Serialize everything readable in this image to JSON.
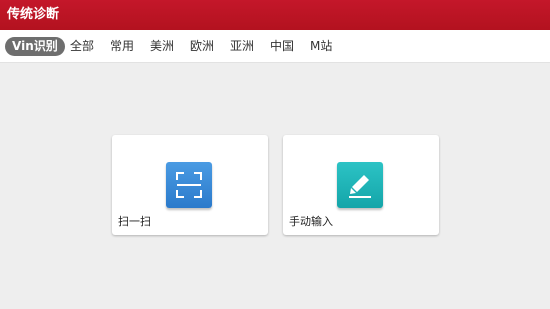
{
  "app": {
    "title": "传统诊断"
  },
  "tabs": [
    {
      "label": "Vin识别",
      "active": true
    },
    {
      "label": "全部"
    },
    {
      "label": "常用"
    },
    {
      "label": "美洲"
    },
    {
      "label": "欧洲"
    },
    {
      "label": "亚洲"
    },
    {
      "label": "中国"
    },
    {
      "label": "M站"
    }
  ],
  "cards": [
    {
      "label": "扫一扫",
      "icon": "scan-icon",
      "color": "#3b8ad8"
    },
    {
      "label": "手动输入",
      "icon": "edit-pencil-icon",
      "color": "#1fb4b7"
    }
  ],
  "colors": {
    "header": "#c0162a",
    "active_tab": "#6e6e6e",
    "background": "#eeeeee"
  }
}
